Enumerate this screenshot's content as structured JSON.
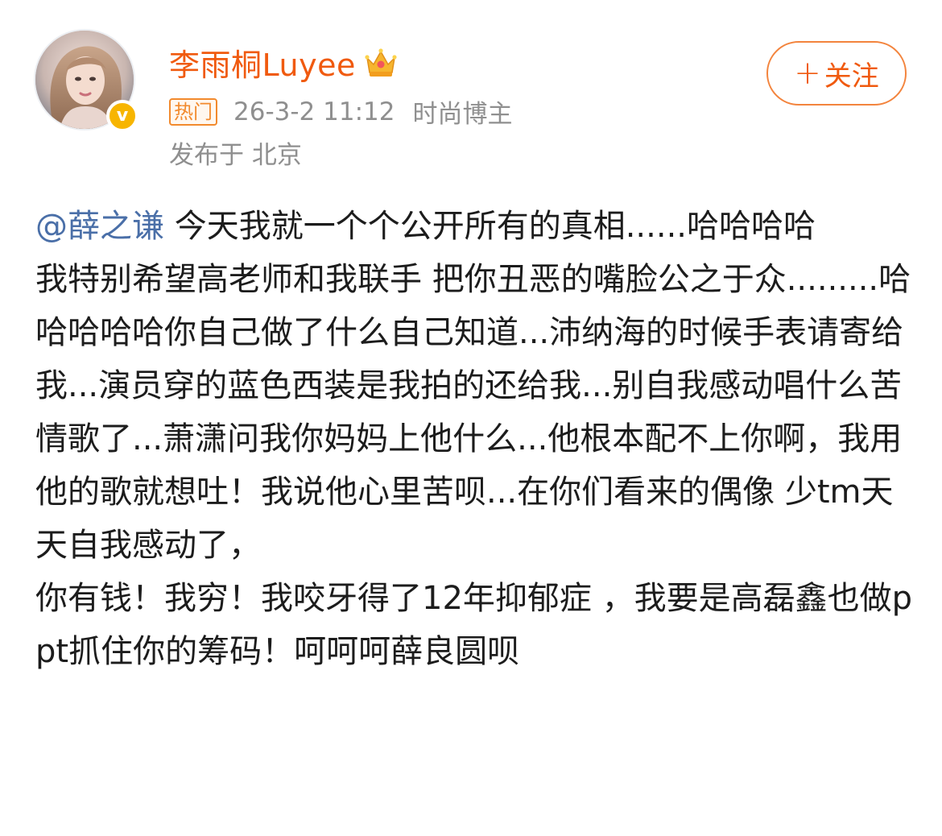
{
  "user": {
    "name": "李雨桐Luyee",
    "verified_mark": "v",
    "crown_icon": "crown-icon",
    "hot_badge": "热门",
    "post_time": "26-3-2 11:12",
    "user_tag": "时尚博主",
    "location": "发布于 北京"
  },
  "follow": {
    "plus": "+",
    "label": "关注"
  },
  "post": {
    "mention": "@薛之谦",
    "line1_rest": " 今天我就一个个公开所有的真相......哈哈哈哈",
    "paragraph2": "我特别希望高老师和我联手 把你丑恶的嘴脸公之于众.........哈哈哈哈哈你自己做了什么自己知道...沛纳海的时候手表请寄给我...演员穿的蓝色西装是我拍的还给我...别自我感动唱什么苦情歌了...萧潇问我你妈妈上他什么...他根本配不上你啊，我用他的歌就想吐！我说他心里苦呗...在你们看来的偶像 少tm天天自我感动了，",
    "paragraph3": "你有钱！我穷！我咬牙得了12年抑郁症 ，我要是高磊鑫也做ppt抓住你的筹码！呵呵呵薛良圆呗"
  },
  "colors": {
    "name_orange": "#f05a0f",
    "mention_blue": "#4a6fa8",
    "meta_gray": "#8f8f8f",
    "badge_orange": "#f28a2d",
    "verified_yellow": "#f7b500"
  }
}
